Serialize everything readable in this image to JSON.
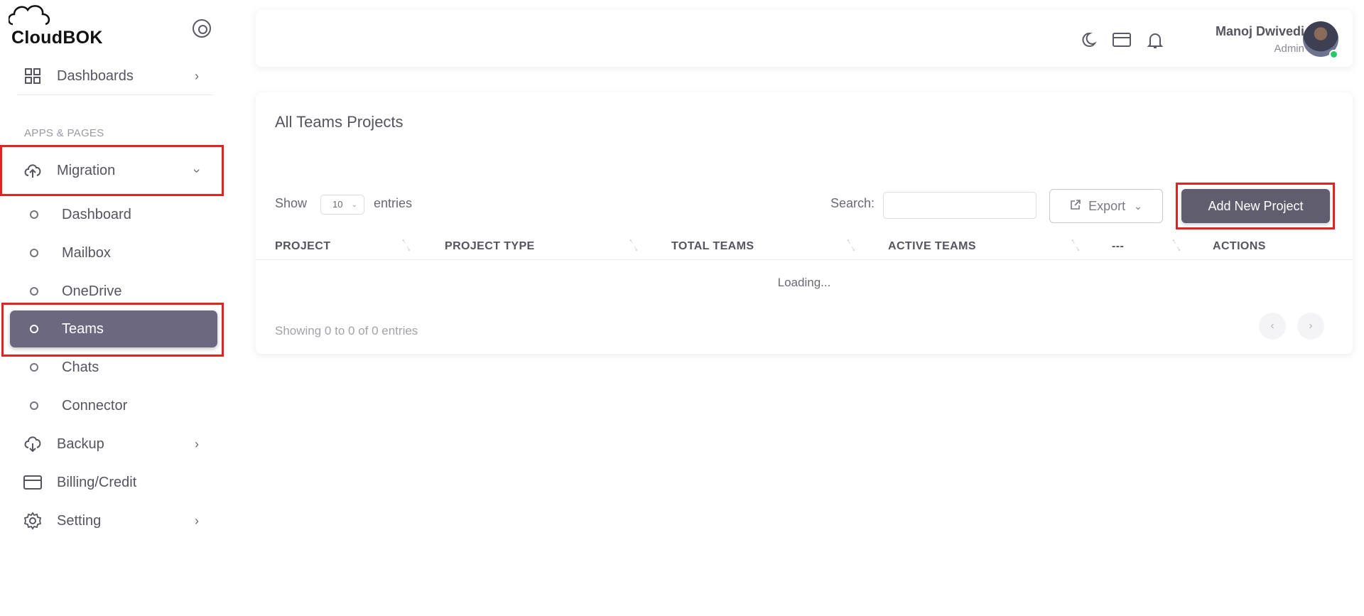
{
  "brand": {
    "logo_text": "CloudBOK"
  },
  "sidebar": {
    "dashboards_label": "Dashboards",
    "section_label": "APPS & PAGES",
    "migration_label": "Migration",
    "sub_items": [
      {
        "label": "Dashboard"
      },
      {
        "label": "Mailbox"
      },
      {
        "label": "OneDrive"
      },
      {
        "label": "Teams"
      },
      {
        "label": "Chats"
      },
      {
        "label": "Connector"
      }
    ],
    "backup_label": "Backup",
    "billing_label": "Billing/Credit",
    "setting_label": "Setting",
    "active_item": "Teams"
  },
  "header": {
    "user_name": "Manoj Dwivedi",
    "user_role": "Admin"
  },
  "main": {
    "title": "All Teams Projects",
    "show_label": "Show",
    "page_length": "10",
    "entries_label": "entries",
    "search_label": "Search:",
    "search_value": "",
    "export_label": "Export",
    "add_button_label": "Add New Project",
    "columns": [
      "PROJECT",
      "PROJECT TYPE",
      "TOTAL TEAMS",
      "ACTIVE TEAMS",
      "---",
      "ACTIONS"
    ],
    "loading_text": "Loading...",
    "info_text": "Showing 0 to 0 of 0 entries"
  },
  "colors": {
    "active_item_bg": "#6b6880",
    "primary_button": "#5f5d6e",
    "highlight": "#e02424",
    "online_status": "#28c76f"
  }
}
